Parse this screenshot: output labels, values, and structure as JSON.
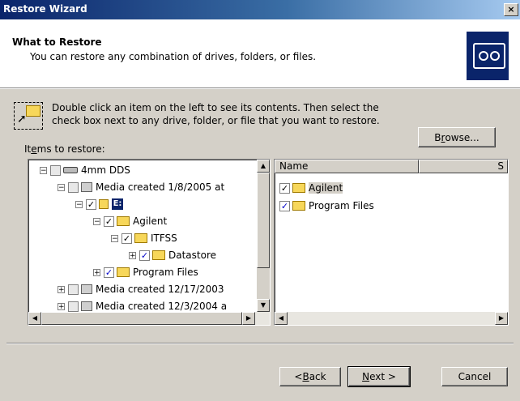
{
  "window": {
    "title": "Restore Wizard",
    "close_label": "×"
  },
  "header": {
    "title": "What to Restore",
    "subtitle": "You can restore any combination of drives, folders, or files."
  },
  "instructions": "Double click an item on the left to see its contents. Then select the check box next to any drive, folder, or file that you want to restore.",
  "browse_label": "Browse...",
  "items_label": "Items to restore:",
  "tree": [
    {
      "label": "4mm DDS",
      "expander": "−",
      "check": "",
      "icon": "drive-icon"
    },
    {
      "label": "Media created 1/8/2005 at",
      "expander": "−",
      "check": "",
      "icon": "media-icon"
    },
    {
      "label": "E:",
      "expander": "−",
      "check": "✓",
      "icon": "drive-e-icon",
      "selected": true
    },
    {
      "label": "Agilent",
      "expander": "−",
      "check": "✓",
      "icon": "folder-icon"
    },
    {
      "label": "ITFSS",
      "expander": "−",
      "check": "✓",
      "icon": "folder-icon"
    },
    {
      "label": "Datastore",
      "expander": "+",
      "check": "✓",
      "icon": "folder-icon",
      "check_color": "blue"
    },
    {
      "label": "Program Files",
      "expander": "+",
      "check": "✓",
      "icon": "folder-icon",
      "check_color": "blue"
    },
    {
      "label": "Media created 12/17/2003",
      "expander": "+",
      "check": "",
      "icon": "media-icon"
    },
    {
      "label": "Media created 12/3/2004 a",
      "expander": "+",
      "check": "",
      "icon": "media-icon"
    }
  ],
  "list": {
    "columns": [
      "Name",
      "S"
    ],
    "items": [
      {
        "label": "Agilent",
        "check": "✓",
        "icon": "folder-icon",
        "selected": true
      },
      {
        "label": "Program Files",
        "check": "✓",
        "icon": "folder-icon",
        "check_color": "blue"
      }
    ]
  },
  "buttons": {
    "back": "< Back",
    "next": "Next >",
    "cancel": "Cancel"
  },
  "colors": {
    "title_start": "#0a246a",
    "title_end": "#a6caf0",
    "face": "#d4d0c8",
    "check_blue": "#0000c8"
  }
}
